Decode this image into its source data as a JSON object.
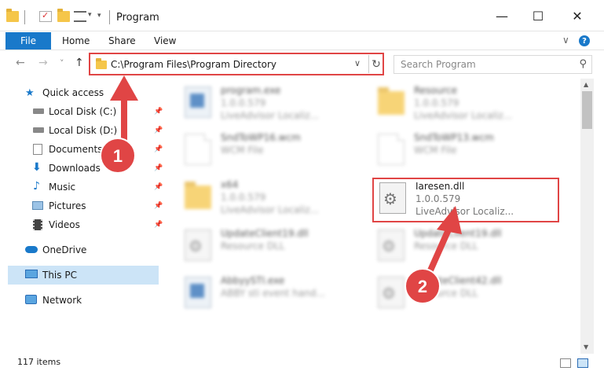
{
  "window": {
    "title": "Program",
    "minimize_glyph": "—",
    "maximize_glyph": "☐",
    "close_glyph": "✕"
  },
  "ribbon": {
    "tabs": [
      {
        "label": "File"
      },
      {
        "label": "Home"
      },
      {
        "label": "Share"
      },
      {
        "label": "View"
      }
    ],
    "expand_glyph": "∨",
    "help_glyph": "?"
  },
  "nav": {
    "back_glyph": "←",
    "forward_glyph": "→",
    "recent_glyph": "˅",
    "up_glyph": "↑",
    "address": "C:\\Program Files\\Program Directory",
    "address_chevron": "∨",
    "refresh_glyph": "↻",
    "search_placeholder": "Search Program",
    "search_glyph": "⚲"
  },
  "sidebar": {
    "items": [
      {
        "label": "Quick access",
        "icon": "star-icon",
        "pinned": false
      },
      {
        "label": "Local Disk (C:)",
        "icon": "drive-icon",
        "pinned": true
      },
      {
        "label": "Local Disk (D:)",
        "icon": "drive-icon",
        "pinned": true
      },
      {
        "label": "Documents",
        "icon": "documents-icon",
        "pinned": true
      },
      {
        "label": "Downloads",
        "icon": "download-icon",
        "pinned": true
      },
      {
        "label": "Music",
        "icon": "music-icon",
        "pinned": true
      },
      {
        "label": "Pictures",
        "icon": "pictures-icon",
        "pinned": true
      },
      {
        "label": "Videos",
        "icon": "videos-icon",
        "pinned": true
      },
      {
        "label": "OneDrive",
        "icon": "cloud-icon",
        "pinned": false
      },
      {
        "label": "This PC",
        "icon": "computer-icon",
        "pinned": false,
        "selected": true
      },
      {
        "label": "Network",
        "icon": "network-icon",
        "pinned": false
      }
    ],
    "pin_glyph": "📌"
  },
  "files": [
    {
      "name": "program.exe",
      "line1": "1.0.0.579",
      "line2": "LiveAdvisor Localiz...",
      "icon": "exe-icon"
    },
    {
      "name": "Resource",
      "line1": "1.0.0.579",
      "line2": "LiveAdvisor Localiz...",
      "icon": "folder-icon"
    },
    {
      "name": "SndToWP16.wcm",
      "line1": "WCM File",
      "line2": "",
      "icon": "document-icon"
    },
    {
      "name": "SndToWP13.wcm",
      "line1": "WCM File",
      "line2": "",
      "icon": "document-icon"
    },
    {
      "name": "x64",
      "line1": "1.0.0.579",
      "line2": "LiveAdvisor Localiz...",
      "icon": "folder-icon"
    },
    {
      "name": "Iaresen.dll",
      "line1": "1.0.0.579",
      "line2": "LiveAdvisor Localiz...",
      "icon": "dll-icon"
    },
    {
      "name": "UpdateClient19.dll",
      "line1": "Resource DLL",
      "line2": "",
      "icon": "dll-icon"
    },
    {
      "name": "UpdateClient19.dll",
      "line1": "Resource DLL",
      "line2": "",
      "icon": "dll-icon"
    },
    {
      "name": "AbbyySTI.exe",
      "line1": "ABBY sti event hand...",
      "line2": "",
      "icon": "exe-icon"
    },
    {
      "name": "UpdateClient42.dll",
      "line1": "Resource DLL",
      "line2": "",
      "icon": "dll-icon"
    }
  ],
  "annotations": {
    "step1": "1",
    "step2": "2",
    "color": "#e04545"
  },
  "status": {
    "item_count": "117 items"
  },
  "colors": {
    "accent": "#1979ca",
    "selection": "#cce4f7",
    "highlight": "#e04545"
  }
}
